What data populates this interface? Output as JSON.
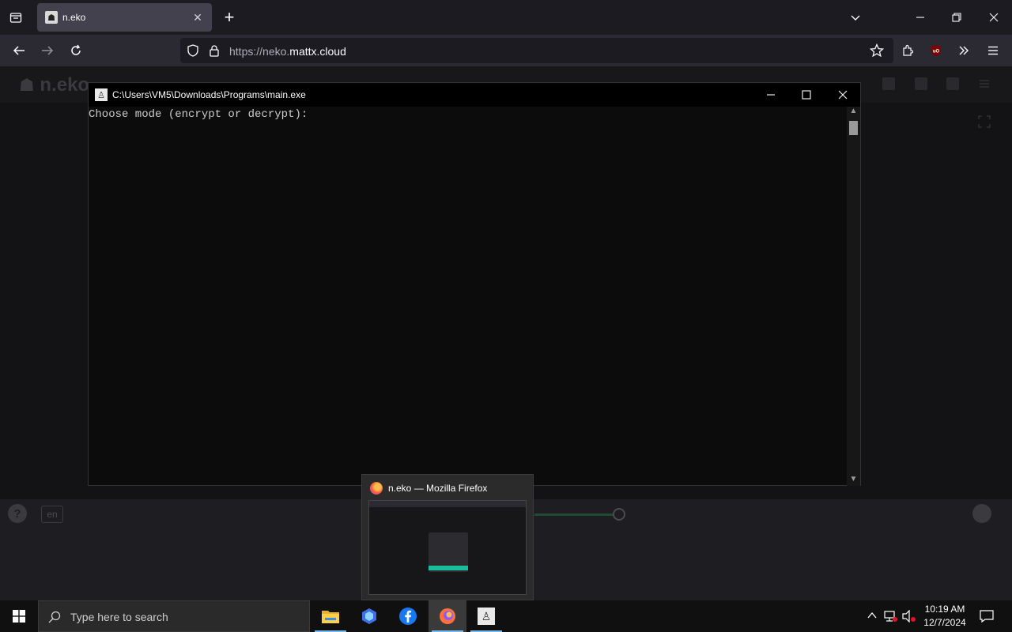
{
  "browser": {
    "tab_title": "n.eko",
    "url_scheme": "https://",
    "url_host_prefix": "neko.",
    "url_host_main": "mattx.cloud"
  },
  "page": {
    "logo_text": "n.eko",
    "lang_label": "en",
    "help_label": "?"
  },
  "console": {
    "title": "C:\\Users\\VM5\\Downloads\\Programs\\main.exe",
    "output_line": "Choose mode (encrypt or decrypt):"
  },
  "thumbnail": {
    "title": "n.eko — Mozilla Firefox"
  },
  "taskbar": {
    "search_placeholder": "Type here to search",
    "time": "10:19 AM",
    "date": "12/7/2024"
  },
  "colors": {
    "accent": "#19bd9c",
    "taskbar_underline": "#76b9ed"
  }
}
